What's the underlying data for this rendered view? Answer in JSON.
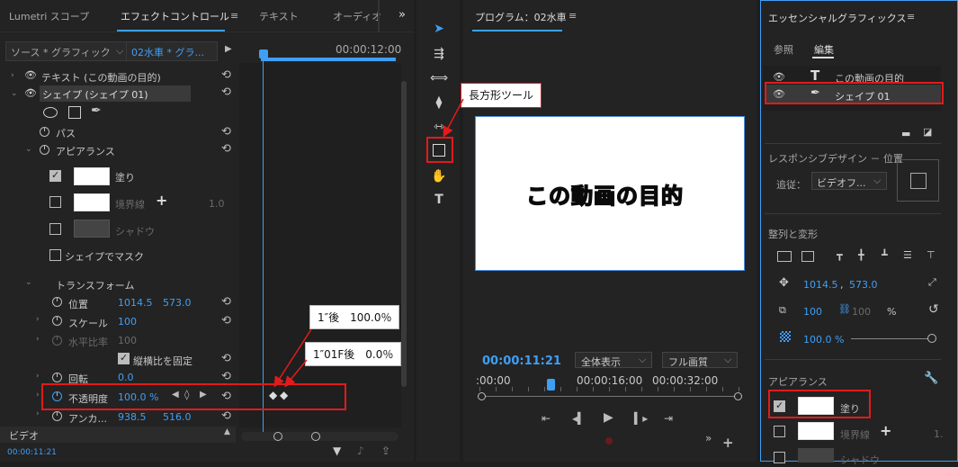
{
  "effect_panel": {
    "tabs": [
      "Lumetri スコープ",
      "エフェクトコントロール",
      "テキスト",
      "オーディオ"
    ],
    "source_dropdown": "ソース * グラフィック",
    "clip_name": "02水車 * グラ...",
    "timecode_top": "00:00:12:00",
    "text_layer": "テキスト (この動画の目的)",
    "shape_layer": "シェイプ (シェイプ 01)",
    "path_label": "パス",
    "appearance_label": "アピアランス",
    "fill_label": "塗り",
    "stroke_label": "境界線",
    "stroke_width": "1.0",
    "shadow_label": "シャドウ",
    "mask_label": "シェイプでマスク",
    "transform_label": "トランスフォーム",
    "position_label": "位置",
    "position_x": "1014.5",
    "position_y": "573.0",
    "scale_label": "スケール",
    "scale_value": "100",
    "scale_width_label": "水平比率",
    "scale_width_value": "100",
    "uniform_label": "縦横比を固定",
    "rotation_label": "回転",
    "rotation_value": "0.0",
    "opacity_label": "不透明度",
    "opacity_value": "100.0 %",
    "anchor_label": "アンカ...",
    "anchor_x": "938.5",
    "anchor_y": "516.0",
    "video_label": "ビデオ",
    "timecode_bottom": "00:00:11:21"
  },
  "callouts": {
    "rect_tool": "長方形ツール",
    "after_1s": "1″後　100.0％",
    "after_1s01f": "1″01F後　0.0％"
  },
  "program": {
    "title": "プログラム：02水車",
    "overlay_text": "この動画の目的",
    "timecode": "00:00:11:21",
    "zoom": "全体表示",
    "quality": "フル画質",
    "ruler": [
      ":00:00",
      "00:00:16:00",
      "00:00:32:00"
    ]
  },
  "essential": {
    "title": "エッセンシャルグラフィックス",
    "tab_browse": "参照",
    "tab_edit": "編集",
    "layer_text": "この動画の目的",
    "layer_shape": "シェイプ 01",
    "responsive_label": "レスポンシブデザイン － 位置",
    "pin_label": "追従：",
    "pin_value": "ビデオフ...",
    "align_label": "整列と変形",
    "pos_x": "1014.5",
    "pos_y": "573.0",
    "scale": "100",
    "scale_h": "100",
    "percent": "%",
    "opacity": "100.0 %",
    "appearance_label": "アピアランス",
    "fill_label": "塗り",
    "stroke_label": "境界線",
    "shadow_label": "シャドウ",
    "stroke_width": "1."
  },
  "colors": {
    "accent": "#3f9ff5",
    "highlight": "#e21b1b",
    "panel": "#232323"
  }
}
